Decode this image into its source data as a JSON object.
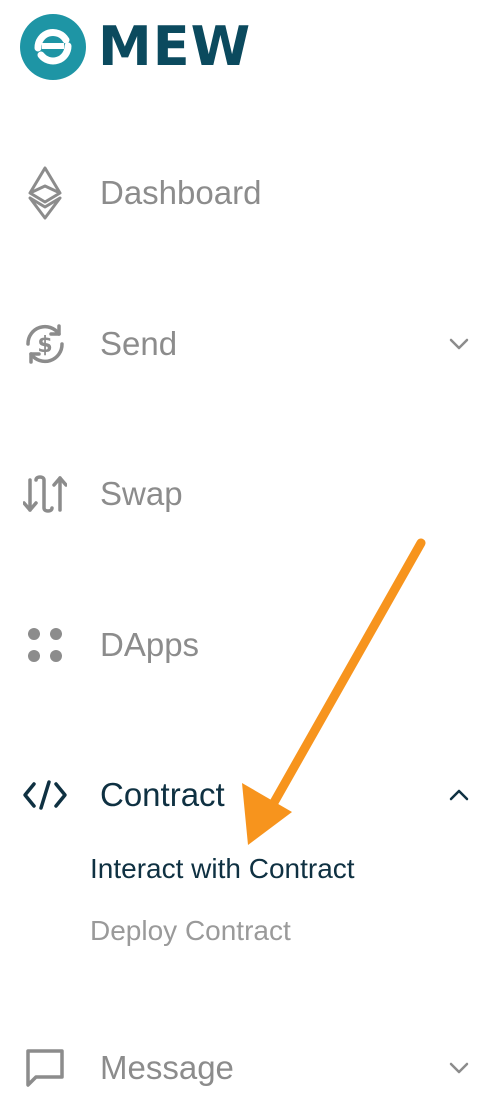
{
  "brand": {
    "name": "MEW",
    "teal": "#1e95a5",
    "navy": "#0b4a5e"
  },
  "nav": {
    "dashboard": {
      "label": "Dashboard",
      "icon": "ethereum-icon"
    },
    "send": {
      "label": "Send",
      "icon": "dollar-cycle-icon",
      "chevron": "chevron-down-icon"
    },
    "swap": {
      "label": "Swap",
      "icon": "swap-arrows-icon"
    },
    "dapps": {
      "label": "DApps",
      "icon": "four-dots-icon"
    },
    "contract": {
      "label": "Contract",
      "icon": "code-icon",
      "chevron": "chevron-up-icon",
      "children": [
        "Interact with Contract",
        "Deploy Contract"
      ]
    },
    "message": {
      "label": "Message",
      "icon": "chat-bubble-icon",
      "chevron": "chevron-down-icon"
    }
  },
  "colors": {
    "inactive_text": "#8c8c8c",
    "active_text": "#0f3142",
    "annotation_arrow": "#f7941d"
  }
}
